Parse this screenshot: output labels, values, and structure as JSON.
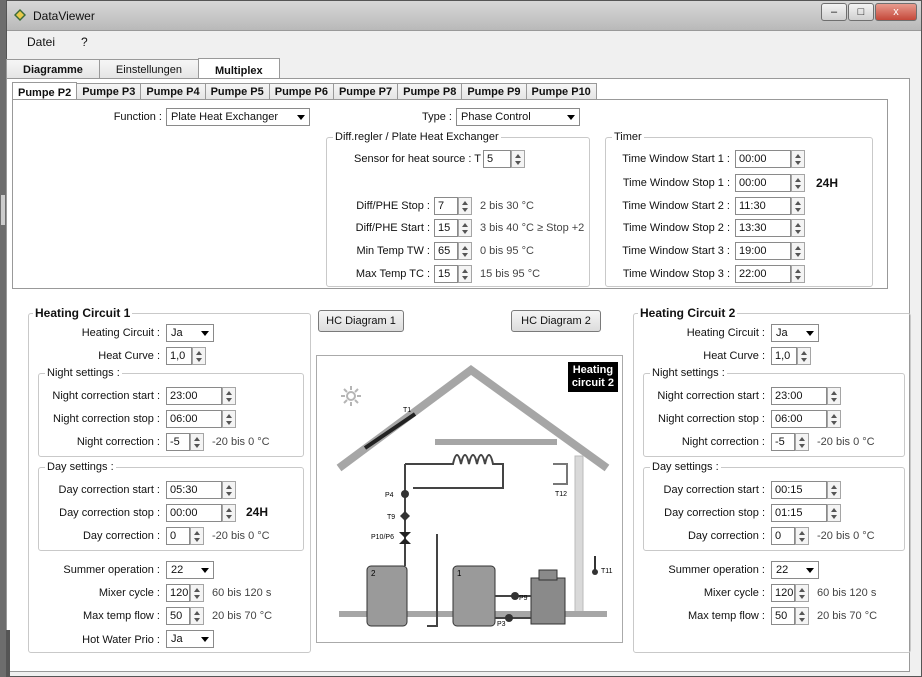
{
  "window": {
    "title": "DataViewer",
    "minimize": "–",
    "maximize": "□",
    "close": "x"
  },
  "menu": [
    "Datei",
    "?"
  ],
  "main_tabs": [
    "Diagramme",
    "Einstellungen",
    "Multiplex"
  ],
  "pump_tabs": [
    "Pumpe P2",
    "Pumpe P3",
    "Pumpe P4",
    "Pumpe P5",
    "Pumpe P6",
    "Pumpe P7",
    "Pumpe P8",
    "Pumpe P9",
    "Pumpe P10"
  ],
  "function": {
    "label": "Function :",
    "value": "Plate Heat Exchanger"
  },
  "type": {
    "label": "Type :",
    "value": "Phase Control"
  },
  "diff": {
    "title": "Diff.regler / Plate Heat Exchanger",
    "sensor_label": "Sensor for heat source : T",
    "sensor_value": "5",
    "rows": [
      {
        "label": "Diff/PHE Stop :",
        "value": "7",
        "range": "2 bis 30 °C"
      },
      {
        "label": "Diff/PHE Start :",
        "value": "15",
        "range": "3 bis 40 °C ≥ Stop +2"
      },
      {
        "label": "Min Temp TW :",
        "value": "65",
        "range": "0 bis 95 °C"
      },
      {
        "label": "Max Temp TC :",
        "value": "15",
        "range": "15 bis 95 °C"
      }
    ]
  },
  "timer": {
    "title": "Timer",
    "rows": [
      {
        "label": "Time Window Start 1 :",
        "value": "00:00"
      },
      {
        "label": "Time Window Stop 1 :",
        "value": "00:00"
      },
      {
        "label": "Time Window Start 2 :",
        "value": "11:30"
      },
      {
        "label": "Time Window Stop 2 :",
        "value": "13:30"
      },
      {
        "label": "Time Window Start 3 :",
        "value": "19:00"
      },
      {
        "label": "Time Window Stop 3 :",
        "value": "22:00"
      }
    ],
    "badge": "24H"
  },
  "hc1": {
    "title": "Heating Circuit 1",
    "heating_circuit": {
      "label": "Heating Circuit :",
      "value": "Ja"
    },
    "heat_curve": {
      "label": "Heat Curve :",
      "value": "1,0"
    },
    "night": {
      "title": "Night settings :",
      "start": {
        "label": "Night correction start :",
        "value": "23:00"
      },
      "stop": {
        "label": "Night correction stop :",
        "value": "06:00"
      },
      "corr": {
        "label": "Night correction :",
        "value": "-5",
        "range": "-20 bis 0 °C"
      }
    },
    "day": {
      "title": "Day settings :",
      "start": {
        "label": "Day correction start :",
        "value": "05:30"
      },
      "stop": {
        "label": "Day correction stop :",
        "value": "00:00"
      },
      "corr": {
        "label": "Day correction :",
        "value": "0",
        "range": "-20 bis 0 °C"
      },
      "badge": "24H"
    },
    "summer": {
      "label": "Summer operation :",
      "value": "22"
    },
    "mixer": {
      "label": "Mixer cycle :",
      "value": "120",
      "range": "60 bis 120  s"
    },
    "maxflow": {
      "label": "Max temp flow :",
      "value": "50",
      "range": "20 bis 70 °C"
    },
    "hwprio": {
      "label": "Hot Water Prio :",
      "value": "Ja"
    }
  },
  "hc2": {
    "title": "Heating Circuit 2",
    "heating_circuit": {
      "label": "Heating Circuit :",
      "value": "Ja"
    },
    "heat_curve": {
      "label": "Heat Curve :",
      "value": "1,0"
    },
    "night": {
      "title": "Night settings :",
      "start": {
        "label": "Night correction start :",
        "value": "23:00"
      },
      "stop": {
        "label": "Night correction stop :",
        "value": "06:00"
      },
      "corr": {
        "label": "Night correction :",
        "value": "-5",
        "range": "-20 bis 0 °C"
      }
    },
    "day": {
      "title": "Day settings :",
      "start": {
        "label": "Day correction start :",
        "value": "00:15"
      },
      "stop": {
        "label": "Day correction stop :",
        "value": "01:15"
      },
      "corr": {
        "label": "Day correction :",
        "value": "0",
        "range": "-20 bis 0 °C"
      }
    },
    "summer": {
      "label": "Summer operation :",
      "value": "22"
    },
    "mixer": {
      "label": "Mixer cycle :",
      "value": "120",
      "range": "60 bis 120  s"
    },
    "maxflow": {
      "label": "Max temp flow :",
      "value": "50",
      "range": "20 bis 70 °C"
    }
  },
  "hc_buttons": {
    "d1": "HC Diagram 1",
    "d2": "HC Diagram 2"
  },
  "diagram": {
    "badge_line1": "Heating",
    "badge_line2": "circuit 2",
    "labels": {
      "t1": "T1",
      "p4": "P4",
      "t9": "T9",
      "p10p6": "P10/P6",
      "t12": "T12",
      "t11": "T11",
      "p9": "P9",
      "p3": "P3",
      "tank1": "1",
      "tank2": "2"
    }
  }
}
